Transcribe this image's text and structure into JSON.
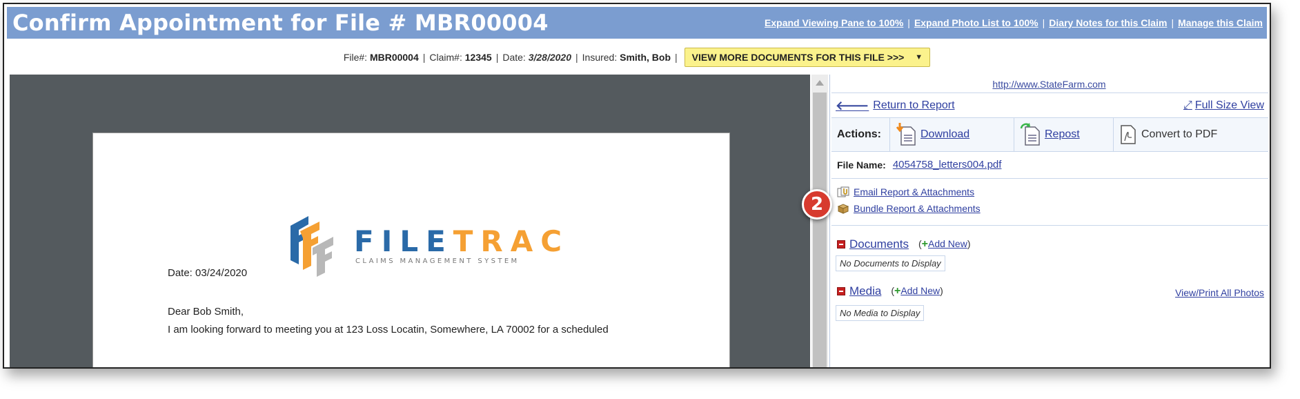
{
  "header": {
    "title": "Confirm Appointment for File # MBR00004",
    "links": [
      "Expand Viewing Pane to 100%",
      "Expand Photo List to 100%",
      "Diary Notes for this Claim",
      "Manage this Claim"
    ]
  },
  "info": {
    "file_label": "File#:",
    "file_value": "MBR00004",
    "claim_label": "Claim#:",
    "claim_value": "12345",
    "date_label": "Date:",
    "date_value": "3/28/2020",
    "insured_label": "Insured:",
    "insured_value": "Smith, Bob",
    "view_more_button": "VIEW MORE DOCUMENTS FOR THIS FILE >>>",
    "view_more_caret": "▼"
  },
  "document": {
    "logo_part1": "FILE",
    "logo_part2": "TRAC",
    "logo_tagline": "CLAIMS MANAGEMENT SYSTEM",
    "date_line": "Date:  03/24/2020",
    "greeting": "Dear Bob Smith,",
    "body_partial": "I am looking forward to meeting you at 123 Loss Locatin, Somewhere, LA 70002 for a scheduled"
  },
  "panel": {
    "website": "http://www.StateFarm.com",
    "return_link": "Return to Report",
    "fullsize_link": "Full Size View",
    "actions_label": "Actions:",
    "download": "Download",
    "repost": "Repost",
    "convert_pdf": "Convert to PDF",
    "file_name_label": "File Name:",
    "file_name_value": "4054758_letters004.pdf",
    "email_report": "Email Report & Attachments",
    "bundle_report": "Bundle Report & Attachments",
    "documents": {
      "title": "Documents",
      "add_new": "Add New",
      "empty": "No Documents to Display"
    },
    "media": {
      "title": "Media",
      "add_new": "Add New",
      "empty": "No Media to Display"
    },
    "view_print_photos": "View/Print All Photos"
  },
  "badge": {
    "number": "2"
  },
  "colors": {
    "titlebar": "#7b9dd0",
    "button_yellow": "#fbf28c",
    "viewer_bg": "#545a5e",
    "badge_red": "#d73a2e",
    "link_blue": "#2f3fa0",
    "logo_blue": "#2a6aa8",
    "logo_orange": "#f5a033"
  },
  "icons": [
    "arrow-left-icon",
    "expand-icon",
    "download-icon",
    "repost-icon",
    "pdf-icon",
    "email-attach-icon",
    "bundle-box-icon",
    "minus-icon",
    "plus-icon"
  ]
}
